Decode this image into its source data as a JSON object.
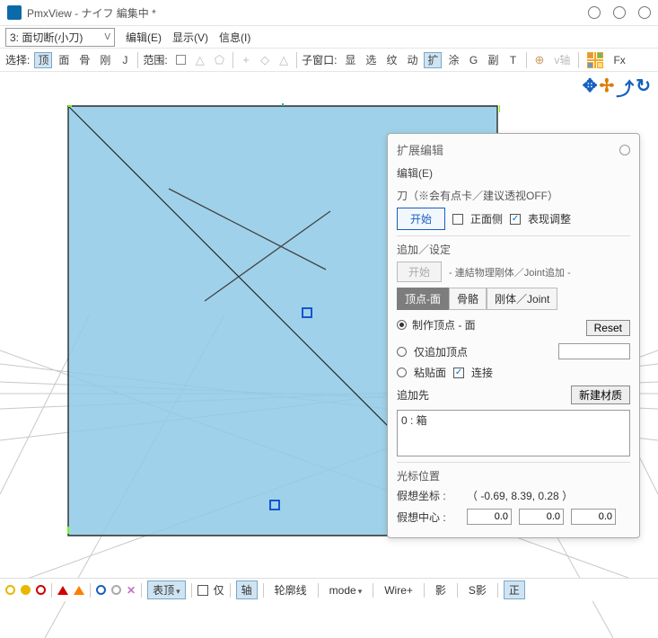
{
  "window": {
    "title": "PmxView - ナイフ 編集中 *"
  },
  "menu": {
    "combo": "3: 面切断(小刀)",
    "edit": "编辑(E)",
    "display": "显示(V)",
    "info": "信息(I)"
  },
  "toolbar": {
    "select_label": "选择:",
    "vert": "顶",
    "face": "面",
    "bone": "骨",
    "rigid": "刚",
    "joint": "J",
    "range_label": "范围:",
    "subwin_label": "子窗口:",
    "sw_xian": "显",
    "sw_xuan": "选",
    "sw_wen": "纹",
    "sw_dong": "动",
    "sw_kuo": "扩",
    "sw_tu": "涂",
    "sw_g": "G",
    "sw_fu": "副",
    "sw_t": "T",
    "vaxis": "v轴",
    "fx": "Fx"
  },
  "panel": {
    "title": "扩展编辑",
    "menu_edit": "编辑(E)",
    "knife_title": "刀（※会有点卡／建议透视OFF）",
    "start": "开始",
    "front_side": "正面侧",
    "adjust": "表现调整",
    "append_title": "追加／设定",
    "start2": "开始",
    "append_desc": "- 連結物理剛体／Joint追加 -",
    "tab_vf": "顶点-面",
    "tab_bone": "骨骼",
    "tab_rj": "刚体／Joint",
    "r_make": "制作顶点 - 面",
    "r_addv": "仅追加顶点",
    "r_paste": "粘贴面",
    "connect": "连接",
    "reset": "Reset",
    "append_to": "追加先",
    "new_mat": "新建材质",
    "list_item": "0 : 箱",
    "cursor_title": "光标位置",
    "coord_label": "假想坐标 :",
    "coord_value": "（ -0.69, 8.39, 0.28 ）",
    "center_label": "假想中心 :",
    "cx": "0.0",
    "cy": "0.0",
    "cz": "0.0"
  },
  "status": {
    "vshow": "表顶",
    "only": "仅",
    "axis": "轴",
    "outline": "轮廓线",
    "mode": "mode",
    "wire": "Wire+",
    "shadow": "影",
    "sshadow": "S影",
    "ortho": "正"
  },
  "chart_data": {
    "type": "none"
  }
}
